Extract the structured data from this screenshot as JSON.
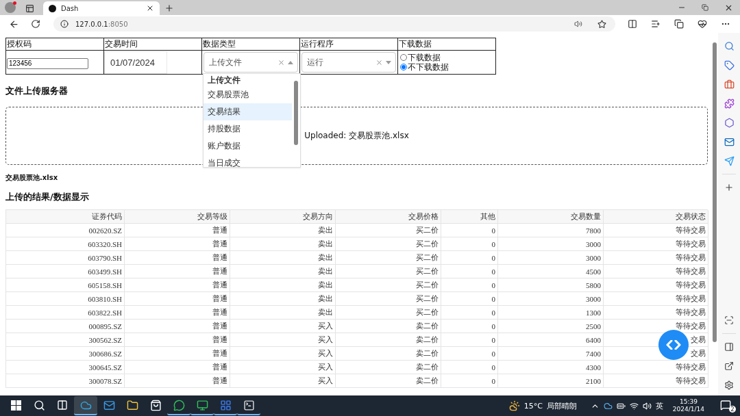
{
  "browser": {
    "tabs": [
      {
        "title": "Dash",
        "selected": true
      }
    ],
    "address": {
      "host": "127.0.0.1",
      "port": ":8050"
    }
  },
  "form": {
    "headers": [
      "授权码",
      "交易时间",
      "数据类型",
      "运行程序",
      "下载数据"
    ],
    "auth_code": {
      "value": "123456"
    },
    "trade_date": {
      "value": "01/07/2024"
    },
    "data_type": {
      "value": "上传文件",
      "expanded": true,
      "options": [
        {
          "label": "上传文件",
          "selected": true,
          "hovered": false
        },
        {
          "label": "交易股票池",
          "selected": false,
          "hovered": false
        },
        {
          "label": "交易结果",
          "selected": false,
          "hovered": true
        },
        {
          "label": "持股数据",
          "selected": false,
          "hovered": false
        },
        {
          "label": "账户数据",
          "selected": false,
          "hovered": false
        },
        {
          "label": "当日成交",
          "selected": false,
          "hovered": false
        }
      ]
    },
    "run_program": {
      "value": "运行",
      "expanded": false
    },
    "download": {
      "options": [
        {
          "label": "下载数据",
          "selected": false
        },
        {
          "label": "不下载数据",
          "selected": true
        }
      ]
    }
  },
  "upload": {
    "heading": "文件上传服务器",
    "message": "Uploaded: 交易股票池.xlsx",
    "filename": "交易股票池.xlsx"
  },
  "results": {
    "heading": "上传的结果/数据显示",
    "table": {
      "columns": [
        "证券代码",
        "交易等级",
        "交易方向",
        "交易价格",
        "其他",
        "交易数量",
        "交易状态"
      ],
      "rows": [
        [
          "002620.SZ",
          "普通",
          "卖出",
          "买二价",
          "0",
          "7800",
          "等待交易"
        ],
        [
          "603320.SH",
          "普通",
          "卖出",
          "买二价",
          "0",
          "3000",
          "等待交易"
        ],
        [
          "603790.SH",
          "普通",
          "卖出",
          "买二价",
          "0",
          "3000",
          "等待交易"
        ],
        [
          "603499.SH",
          "普通",
          "卖出",
          "买二价",
          "0",
          "4500",
          "等待交易"
        ],
        [
          "605158.SH",
          "普通",
          "卖出",
          "买二价",
          "0",
          "5800",
          "等待交易"
        ],
        [
          "603810.SH",
          "普通",
          "卖出",
          "买二价",
          "0",
          "3000",
          "等待交易"
        ],
        [
          "603822.SH",
          "普通",
          "卖出",
          "买二价",
          "0",
          "1300",
          "等待交易"
        ],
        [
          "000895.SZ",
          "普通",
          "买入",
          "卖二价",
          "0",
          "2500",
          "等待交易"
        ],
        [
          "300562.SZ",
          "普通",
          "买入",
          "卖二价",
          "0",
          "6400",
          "交易"
        ],
        [
          "300686.SZ",
          "普通",
          "买入",
          "卖二价",
          "0",
          "7400",
          "交易"
        ],
        [
          "300645.SZ",
          "普通",
          "买入",
          "卖二价",
          "0",
          "4300",
          "等待交易"
        ],
        [
          "300078.SZ",
          "普通",
          "买入",
          "卖二价",
          "0",
          "2100",
          "等待交易"
        ]
      ]
    }
  },
  "taskbar": {
    "apps": [
      {
        "kind": "edge",
        "selected": true,
        "running": true
      },
      {
        "kind": "mail",
        "selected": false,
        "running": false
      },
      {
        "kind": "folder",
        "selected": false,
        "running": false
      },
      {
        "kind": "store",
        "selected": false,
        "running": false
      },
      {
        "kind": "chat",
        "selected": false,
        "running": true
      },
      {
        "kind": "monitor",
        "selected": false,
        "running": true
      },
      {
        "kind": "m-app",
        "selected": false,
        "running": true
      },
      {
        "kind": "terminal",
        "selected": false,
        "running": true
      }
    ],
    "temperature": "15°C",
    "weather": "局部晴朗",
    "input_method": "英",
    "time": "15:39",
    "date": "2024/1/14",
    "notifications": "2"
  }
}
